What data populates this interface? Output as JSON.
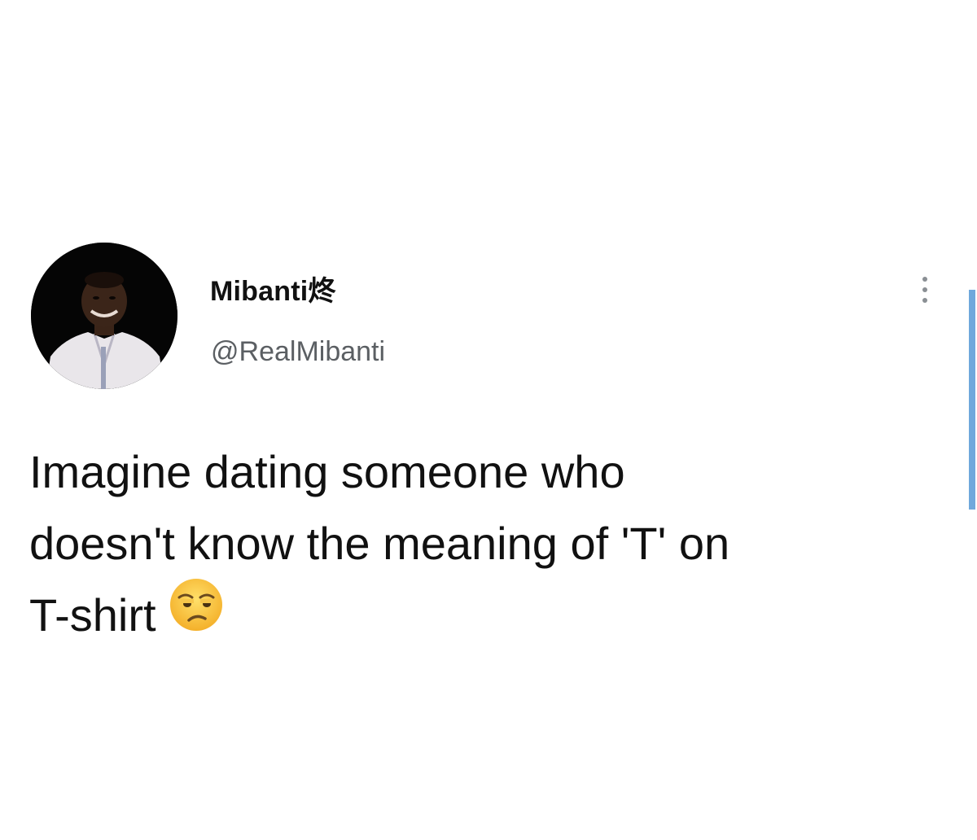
{
  "tweet": {
    "author": {
      "display_name": "Mibanti炵",
      "handle": "@RealMibanti"
    },
    "text_lines": [
      "Imagine dating someone who",
      "doesn't know the meaning of 'T' on",
      "T-shirt"
    ],
    "emoji": "unamused-face-emoji",
    "menu_icon": "more-vertical-icon"
  },
  "colors": {
    "background": "#ffffff",
    "text": "#111111",
    "handle": "#5b5f63",
    "scrollbar": "#6fa8dc"
  }
}
